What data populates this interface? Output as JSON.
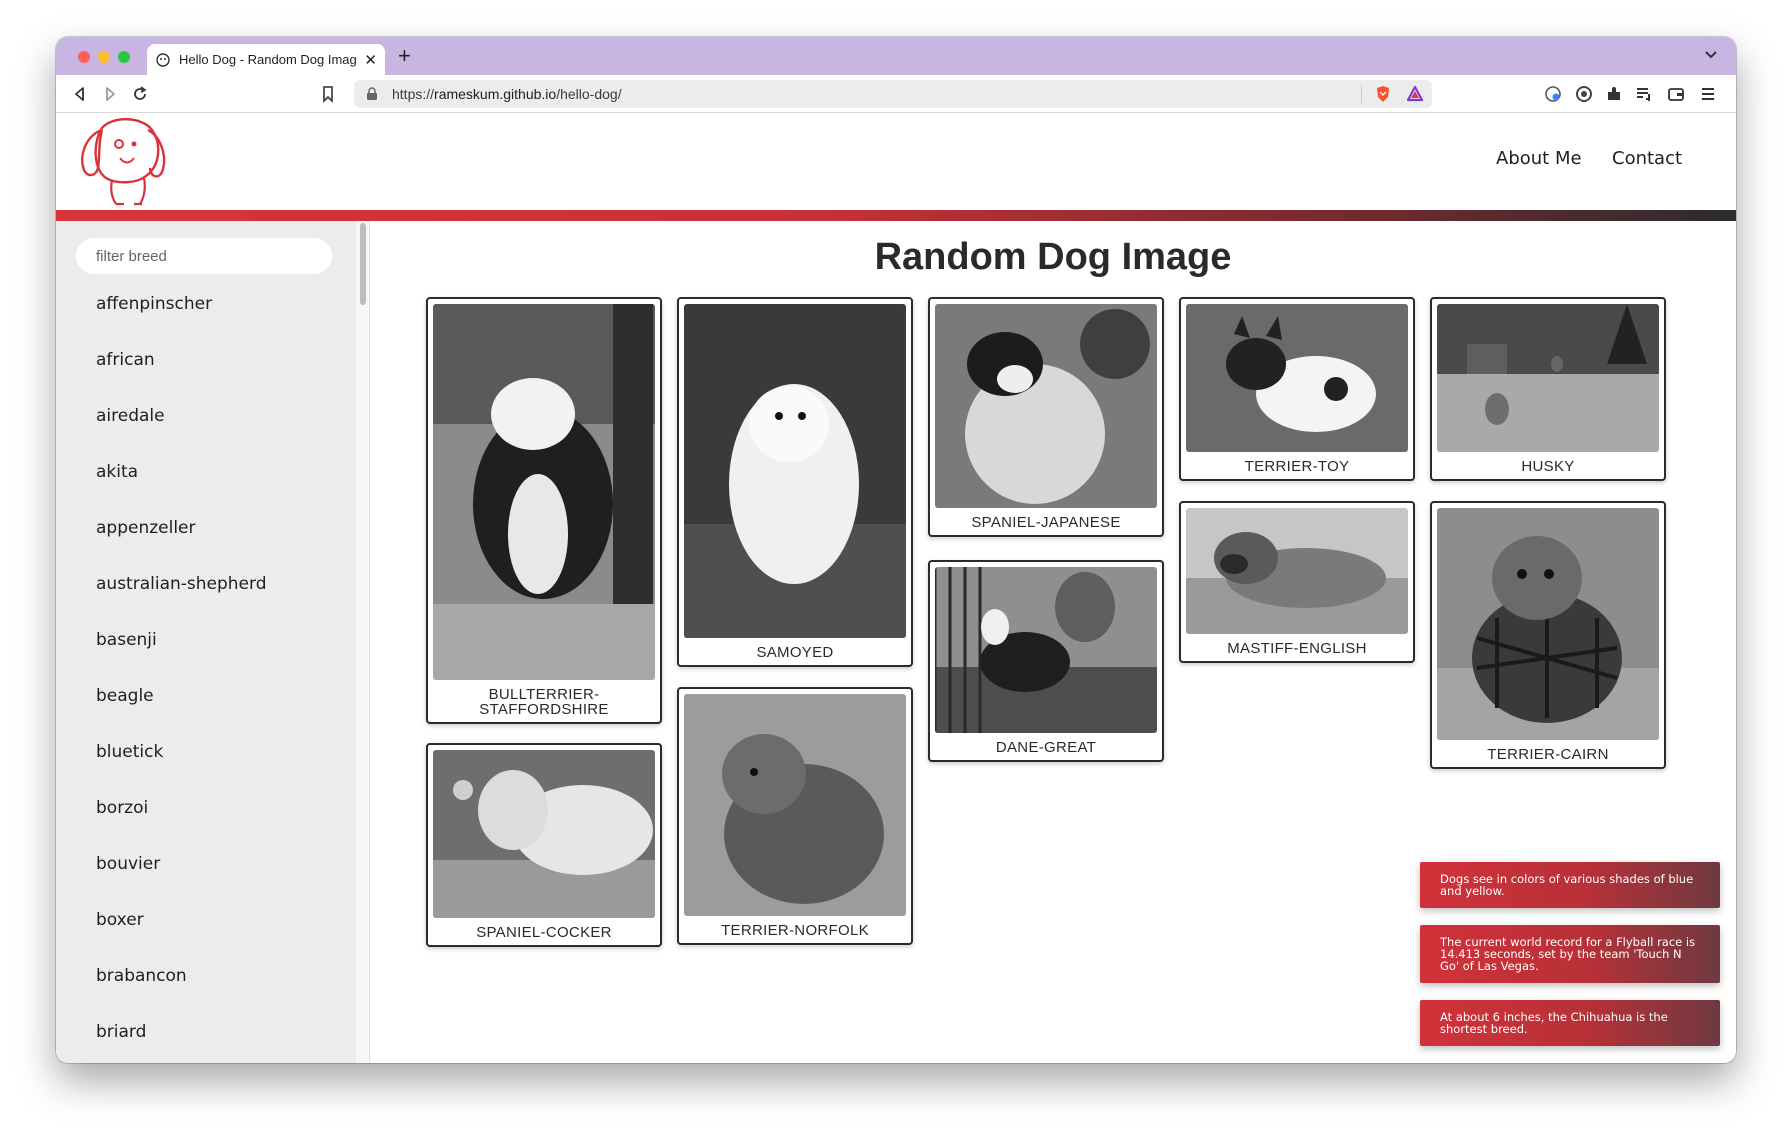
{
  "browser": {
    "tab_title": "Hello Dog - Random Dog Image",
    "url_scheme": "https://",
    "url_host": "rameskum.github.io",
    "url_path": "/hello-dog/"
  },
  "nav": {
    "about": "About Me",
    "contact": "Contact"
  },
  "sidebar": {
    "filter_placeholder": "filter breed",
    "breeds": [
      "affenpinscher",
      "african",
      "airedale",
      "akita",
      "appenzeller",
      "australian-shepherd",
      "basenji",
      "beagle",
      "bluetick",
      "borzoi",
      "bouvier",
      "boxer",
      "brabancon",
      "briard"
    ]
  },
  "main": {
    "title": "Random Dog Image",
    "cards": [
      {
        "label": "BULLTERRIER-STAFFORDSHIRE"
      },
      {
        "label": "SPANIEL-COCKER"
      },
      {
        "label": "SAMOYED"
      },
      {
        "label": "TERRIER-NORFOLK"
      },
      {
        "label": "SPANIEL-JAPANESE"
      },
      {
        "label": "DANE-GREAT"
      },
      {
        "label": "TERRIER-TOY"
      },
      {
        "label": "MASTIFF-ENGLISH"
      },
      {
        "label": "HUSKY"
      },
      {
        "label": "TERRIER-CAIRN"
      }
    ]
  },
  "toasts": [
    "Dogs see in colors of various shades of blue and yellow.",
    "The current world record for a Flyball race is 14.413 seconds, set by the team 'Touch N Go' of Las Vegas.",
    "At about 6 inches, the Chihuahua is the shortest breed."
  ],
  "colors": {
    "accent": "#d9333a",
    "accent_dark": "#2b2b2f",
    "tab_strip": "#c9b5e2"
  }
}
